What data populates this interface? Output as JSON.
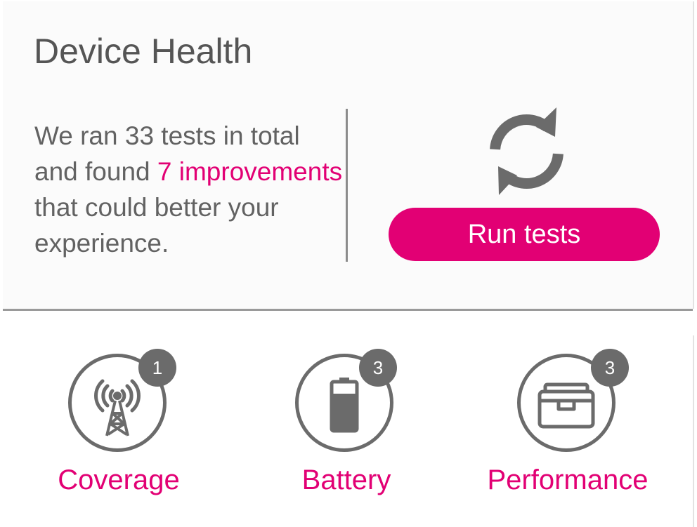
{
  "header": {
    "title": "Device Health"
  },
  "summary": {
    "text_before": "We ran 33 tests in total and found ",
    "highlight": "7 improvements",
    "text_after": " that could better your experience."
  },
  "actions": {
    "refresh_icon": "refresh-icon",
    "run_tests_label": "Run tests"
  },
  "categories": [
    {
      "label": "Coverage",
      "badge": "1",
      "icon": "signal-tower-icon"
    },
    {
      "label": "Battery",
      "badge": "3",
      "icon": "battery-icon"
    },
    {
      "label": "Performance",
      "badge": "3",
      "icon": "toolbox-icon"
    }
  ],
  "colors": {
    "accent": "#e20074",
    "icon_gray": "#6b6b6b",
    "text_gray": "#626262"
  }
}
